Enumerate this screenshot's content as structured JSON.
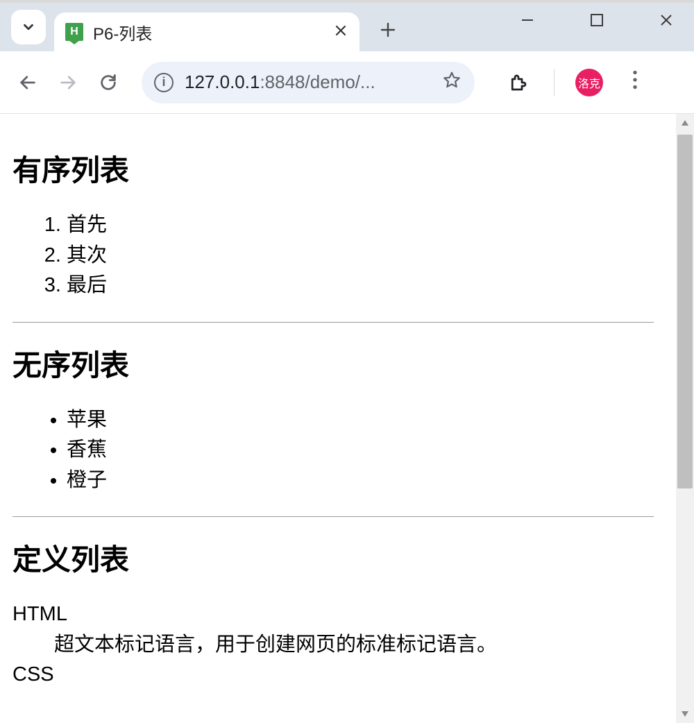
{
  "tab": {
    "favicon_letter": "H",
    "title": "P6-列表"
  },
  "window_controls": {
    "minimize": "—",
    "maximize": "□",
    "close": "✕"
  },
  "toolbar": {
    "url_host": "127.0.0.1",
    "url_port": ":8848",
    "url_path": "/demo/...",
    "profile_label": "洛克"
  },
  "content": {
    "sections": [
      {
        "heading": "有序列表",
        "type": "ol",
        "items": [
          "首先",
          "其次",
          "最后"
        ]
      },
      {
        "heading": "无序列表",
        "type": "ul",
        "items": [
          "苹果",
          "香蕉",
          "橙子"
        ]
      },
      {
        "heading": "定义列表",
        "type": "dl",
        "defs": [
          {
            "term": "HTML",
            "desc": "超文本标记语言，用于创建网页的标准标记语言。"
          },
          {
            "term": "CSS",
            "desc": ""
          }
        ]
      }
    ]
  }
}
